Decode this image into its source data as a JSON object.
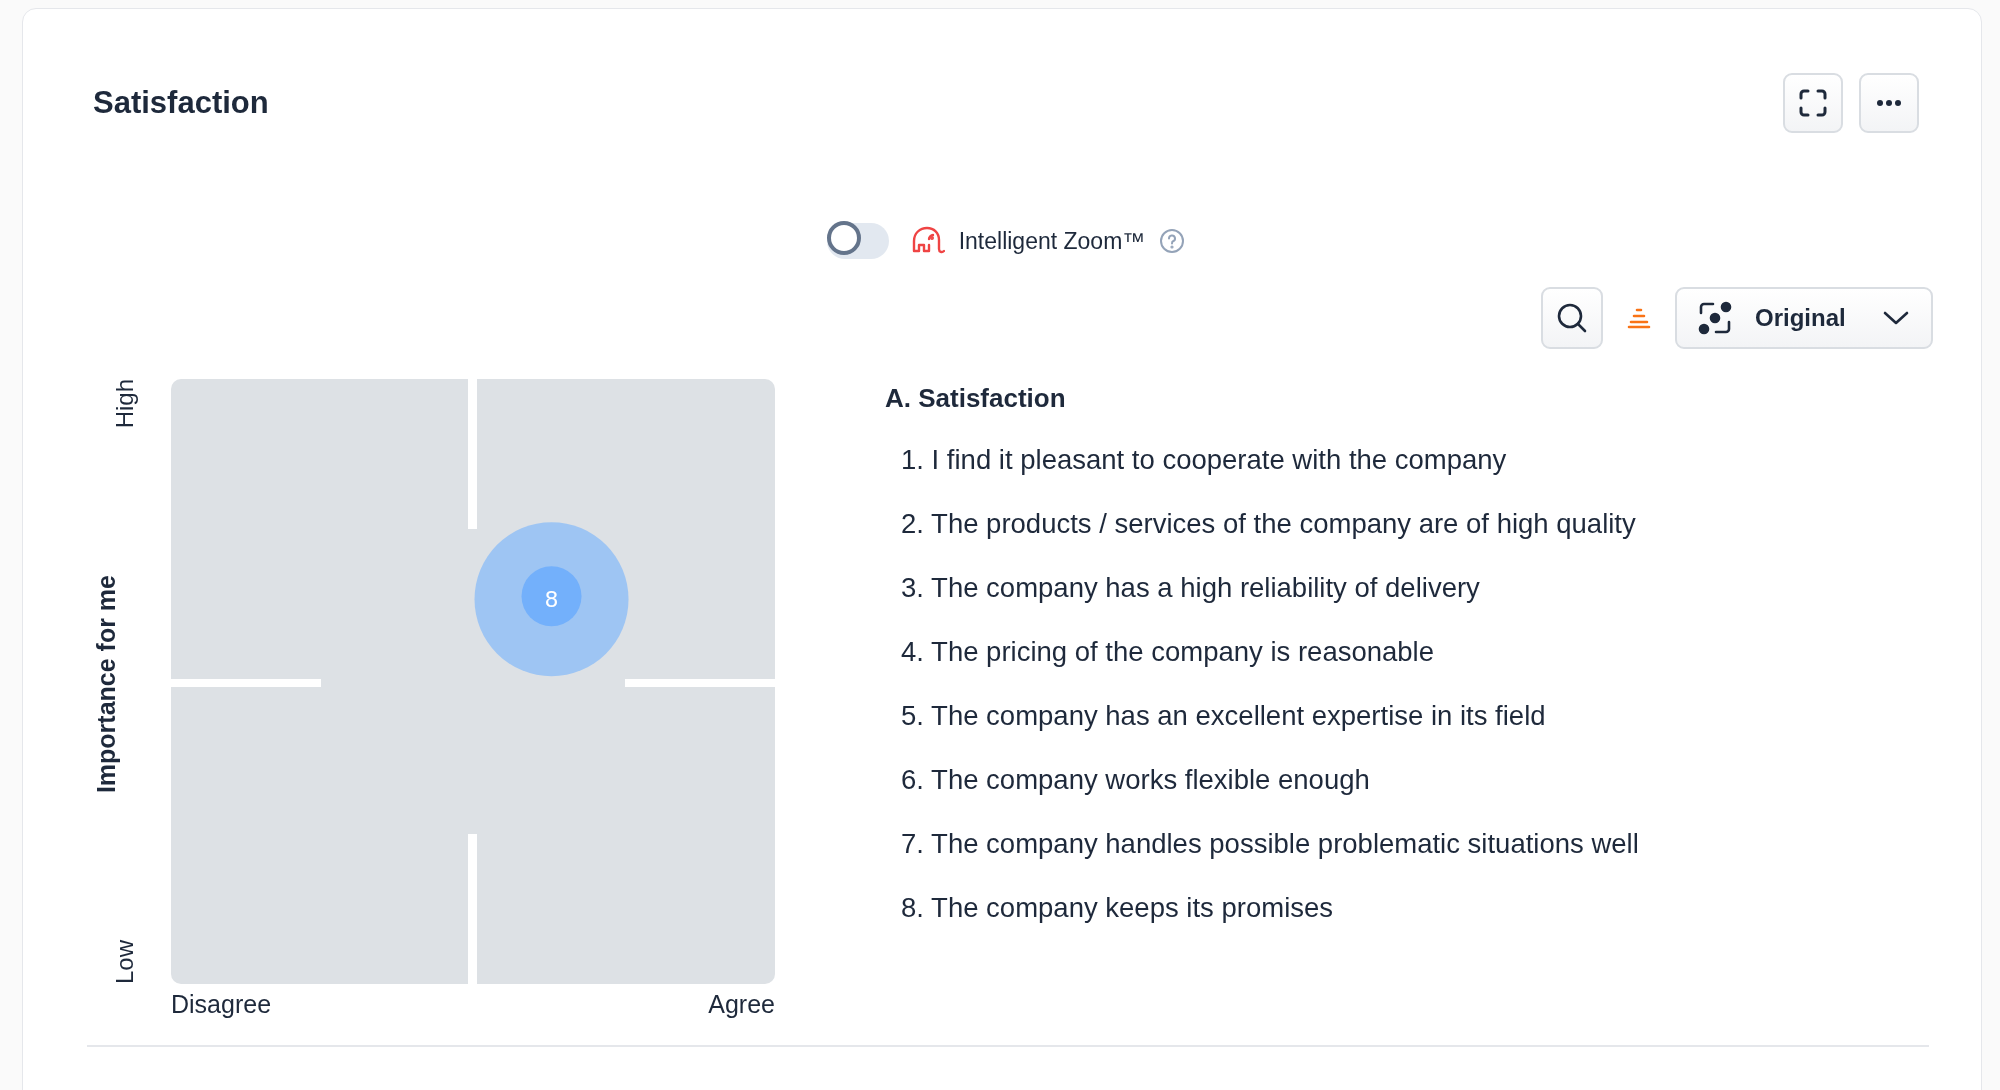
{
  "card": {
    "title": "Satisfaction"
  },
  "intelligent_zoom": {
    "on": false,
    "label": "Intelligent Zoom™"
  },
  "view_select": {
    "value": "Original"
  },
  "matrix": {
    "y_label": "Importance for me",
    "y_high": "High",
    "y_low": "Low",
    "x_low": "Disagree",
    "x_high": "Agree",
    "bubbles": [
      {
        "label": "8"
      }
    ]
  },
  "legend": {
    "heading": "A. Satisfaction",
    "items": [
      "1. I find it pleasant to cooperate with the company",
      "2. The products / services of the company are of high quality",
      "3. The company has a high reliability of delivery",
      "4. The pricing of the company is reasonable",
      "5. The company has an excellent expertise in its field",
      "6. The company works flexible enough",
      "7. The company handles possible problematic situations well",
      "8. The company keeps its promises"
    ]
  }
}
